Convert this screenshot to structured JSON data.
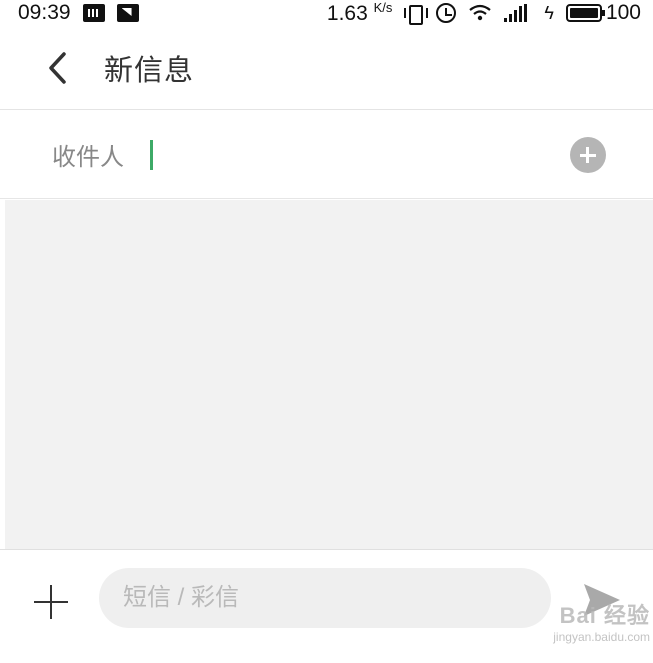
{
  "status_bar": {
    "time": "09:39",
    "net_speed": "1.63",
    "net_speed_unit": "K/s",
    "battery": "100",
    "icons": [
      "keyboard-icon",
      "image-notification-icon",
      "vibrate-icon",
      "alarm-icon",
      "wifi-icon",
      "signal-icon",
      "charging-icon",
      "battery-icon"
    ]
  },
  "header": {
    "title": "新信息",
    "back_icon": "chevron-left-icon"
  },
  "recipient": {
    "label": "收件人",
    "value": "",
    "cursor_color": "#3daa67",
    "add_icon": "plus-circle-icon"
  },
  "compose": {
    "placeholder": "短信 / 彩信",
    "value": "",
    "attach_icon": "plus-icon",
    "send_icon": "send-icon"
  },
  "watermark": {
    "logo": "Bai 经验",
    "url": "jingyan.baidu.com"
  },
  "colors": {
    "accent": "#3daa67",
    "conversation_bg": "#f2f2f2",
    "input_bg": "#efefef"
  }
}
